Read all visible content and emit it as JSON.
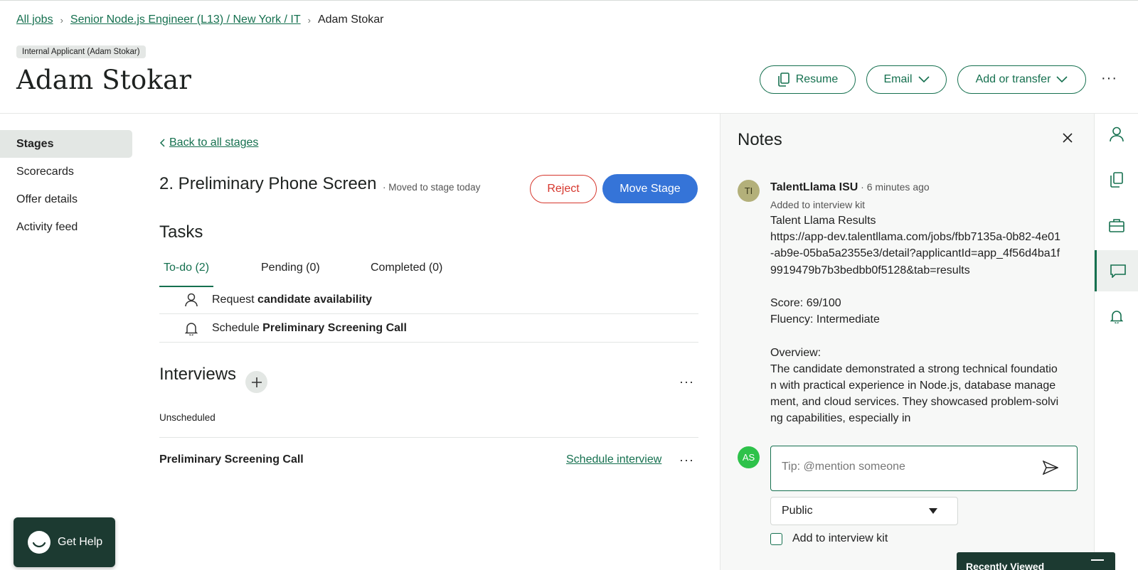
{
  "breadcrumb": {
    "all_jobs": "All jobs",
    "job": "Senior Node.js Engineer (L13) / New York / IT",
    "candidate": "Adam Stokar"
  },
  "header": {
    "badge": "Internal Applicant (Adam Stokar)",
    "title": "Adam Stokar",
    "resume_label": "Resume",
    "email_label": "Email",
    "add_transfer_label": "Add or transfer",
    "more": "···"
  },
  "leftnav": {
    "items": [
      {
        "label": "Stages",
        "active": true
      },
      {
        "label": "Scorecards"
      },
      {
        "label": "Offer details"
      },
      {
        "label": "Activity feed"
      }
    ]
  },
  "stage": {
    "back_label": "Back to all stages",
    "title": "2. Preliminary Phone Screen",
    "meta": "· Moved to stage today",
    "reject_label": "Reject",
    "move_label": "Move Stage"
  },
  "tasks": {
    "heading": "Tasks",
    "tabs": [
      {
        "label": "To-do (2)",
        "active": true
      },
      {
        "label": "Pending (0)"
      },
      {
        "label": "Completed (0)"
      }
    ],
    "items": [
      {
        "prefix": "Request ",
        "bold": "candidate availability",
        "icon": "person-icon"
      },
      {
        "prefix": "Schedule ",
        "bold": "Preliminary Screening Call",
        "icon": "bell-icon"
      }
    ]
  },
  "interviews": {
    "heading": "Interviews",
    "unscheduled_label": "Unscheduled",
    "items": [
      {
        "name": "Preliminary Screening Call",
        "action": "Schedule interview"
      }
    ],
    "more": "···"
  },
  "notes": {
    "title": "Notes",
    "note": {
      "avatar_initials": "TI",
      "author": "TalentLlama ISU",
      "time": " · 6 minutes ago",
      "subtitle": "Added to interview kit",
      "body": "Talent Llama Results\nhttps://app-dev.talentllama.com/jobs/fbb7135a-0b82-4e01-ab9e-05ba5a2355e3/detail?applicantId=app_4f56d4ba1f9919479b7b3bedbb0f5128&tab=results\n\nScore: 69/100\nFluency: Intermediate\n\nOverview:\nThe candidate demonstrated a strong technical foundation with practical experience in Node.js, database management, and cloud services. They showcased problem-solving capabilities, especially in"
    },
    "composer": {
      "avatar_initials": "AS",
      "placeholder": "Tip: @mention someone",
      "visibility": "Public",
      "kit_label": "Add to interview kit"
    }
  },
  "widgets": {
    "get_help": "Get Help",
    "recently_viewed": "Recently Viewed"
  },
  "colors": {
    "brand_green": "#15704f",
    "primary_blue": "#3574d8",
    "reject_red": "#d6362c",
    "dark_widget": "#1c3a31"
  }
}
